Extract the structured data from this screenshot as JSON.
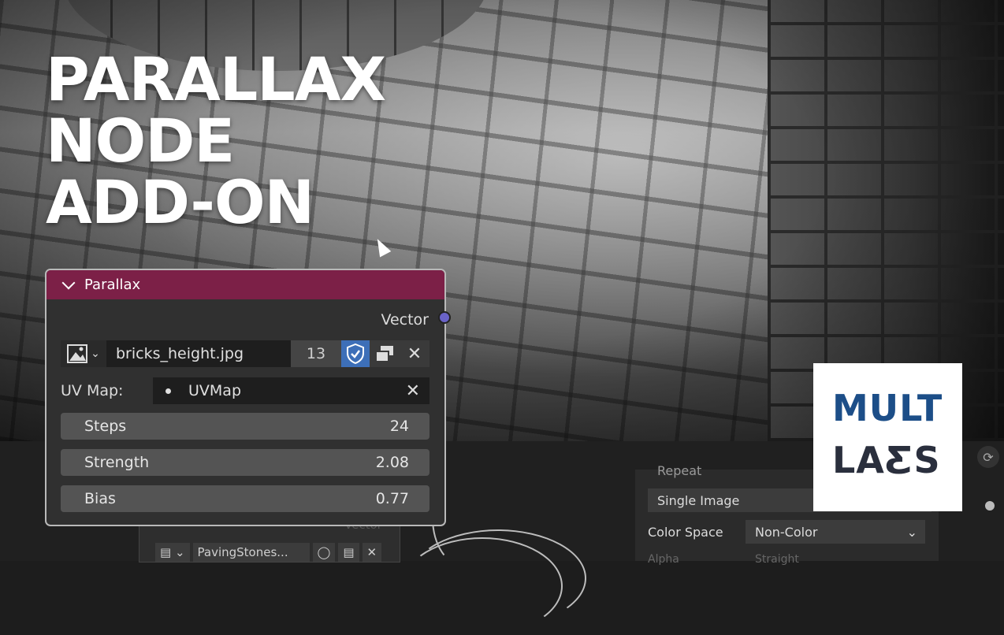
{
  "headline": {
    "line1": "PARALLAX",
    "line2": "NODE",
    "line3": "ADD-ON"
  },
  "node": {
    "title": "Parallax",
    "output_socket": "Vector",
    "image": {
      "name": "bricks_height.jpg",
      "users": "13"
    },
    "uv_map": {
      "label": "UV Map:",
      "value": "UVMap"
    },
    "fields": [
      {
        "label": "Steps",
        "value": "24"
      },
      {
        "label": "Strength",
        "value": "2.08"
      },
      {
        "label": "Bias",
        "value": "0.77"
      }
    ]
  },
  "background_node": {
    "image_name": "PavingStones...",
    "faded_label": "Vector"
  },
  "image_properties": {
    "extension_partial": "Repeat",
    "projection": "Single Image",
    "color_space_label": "Color Space",
    "color_space_value": "Non-Color",
    "alpha_label_partial": "Alpha",
    "alpha_value_partial": "Straight"
  },
  "logo": {
    "line1": "MULT",
    "line2": "LAƸS"
  },
  "colors": {
    "node_header": "#7c2047",
    "socket": "#6a63c8",
    "fake_user": "#3d6fb8",
    "logo_blue": "#1c4e88"
  }
}
